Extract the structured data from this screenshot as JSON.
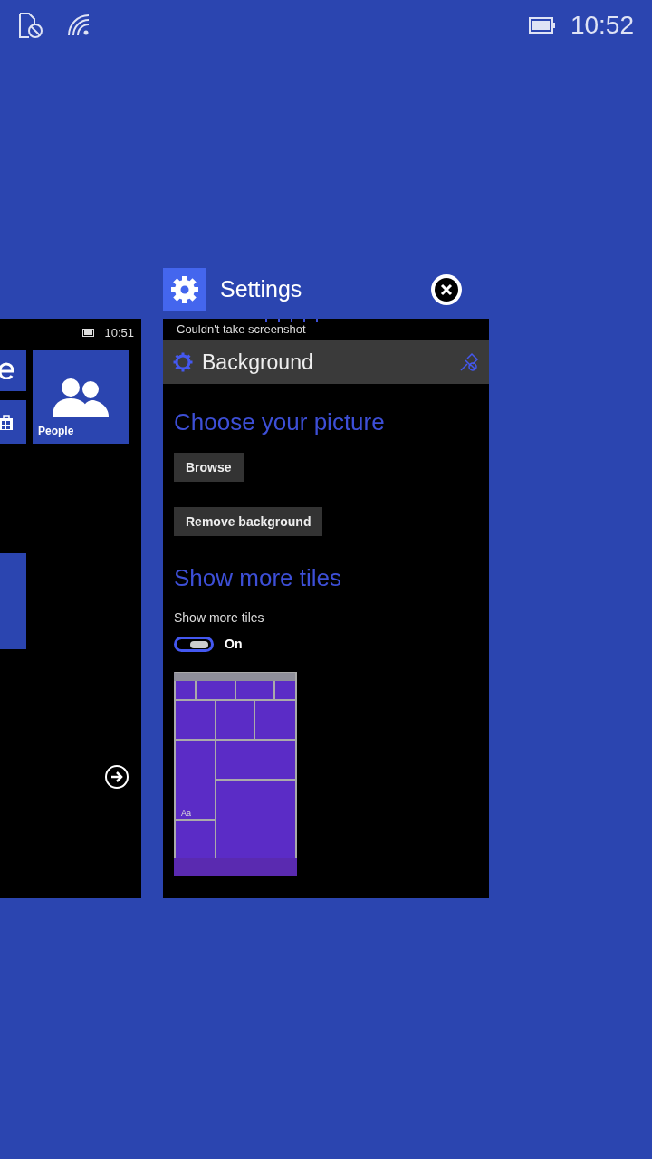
{
  "status_bar": {
    "time": "10:52"
  },
  "start_screen": {
    "time": "10:51",
    "tiles": [
      {
        "kind": "browser"
      },
      {
        "kind": "store"
      },
      {
        "kind": "people",
        "label": "People"
      },
      {
        "kind": "blank"
      }
    ]
  },
  "settings_app": {
    "title": "Settings",
    "notice": "Couldn't take screenshot",
    "page_title": "Background",
    "sections": [
      {
        "heading": "Choose your picture",
        "buttons": [
          "Browse",
          "Remove background"
        ]
      },
      {
        "heading": "Show more tiles",
        "toggle": {
          "label": "Show more tiles",
          "on": true,
          "state_text": "On"
        },
        "preview": {
          "kind": "picture_layout",
          "sample_text": "Aa"
        }
      }
    ]
  }
}
